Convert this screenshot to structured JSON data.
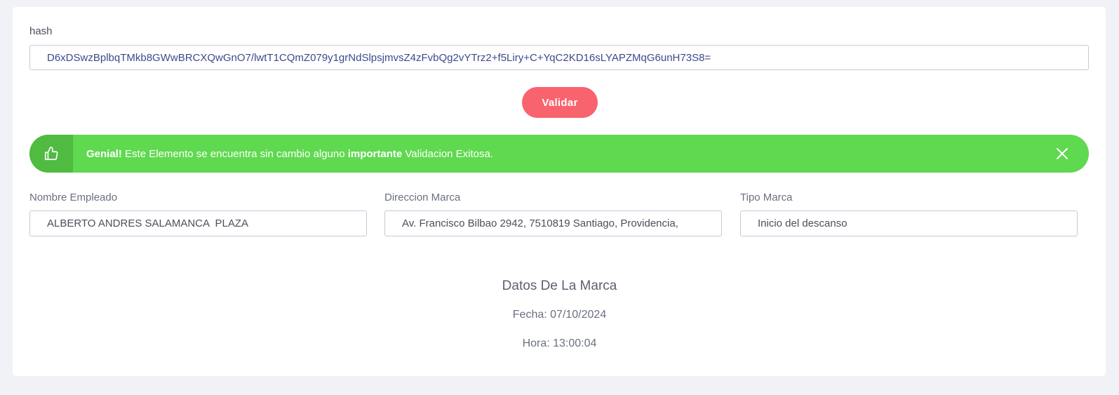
{
  "form": {
    "hash_label": "hash",
    "hash_value": "D6xDSwzBplbqTMkb8GWwBRCXQwGnO7/lwtT1CQmZ079y1grNdSlpsjmvsZ4zFvbQg2vYTrz2+f5Liry+C+YqC2KD16sLYAPZMqG6unH73S8=",
    "validate_label": "Validar"
  },
  "alert": {
    "strong_prefix": "Genial!",
    "text_middle": " Este Elemento se encuentra sin cambio alguno ",
    "strong_mid": "importante",
    "text_end": " Validacion Exitosa.",
    "icon": "thumbs-up-icon",
    "close_icon": "close-icon",
    "color": "#5fd94f",
    "icon_bg": "#4fbb40"
  },
  "fields": {
    "employee_label": "Nombre Empleado",
    "employee_value": "ALBERTO ANDRES SALAMANCA  PLAZA",
    "address_label": "Direccion Marca",
    "address_value": "Av. Francisco Bilbao 2942, 7510819 Santiago, Providencia,",
    "type_label": "Tipo Marca",
    "type_value": "Inicio del descanso"
  },
  "details": {
    "title": "Datos De La Marca",
    "date": "Fecha: 07/10/2024",
    "time": "Hora: 13:00:04"
  },
  "colors": {
    "accent_button": "#f8636d",
    "background": "#f1f2f7"
  }
}
